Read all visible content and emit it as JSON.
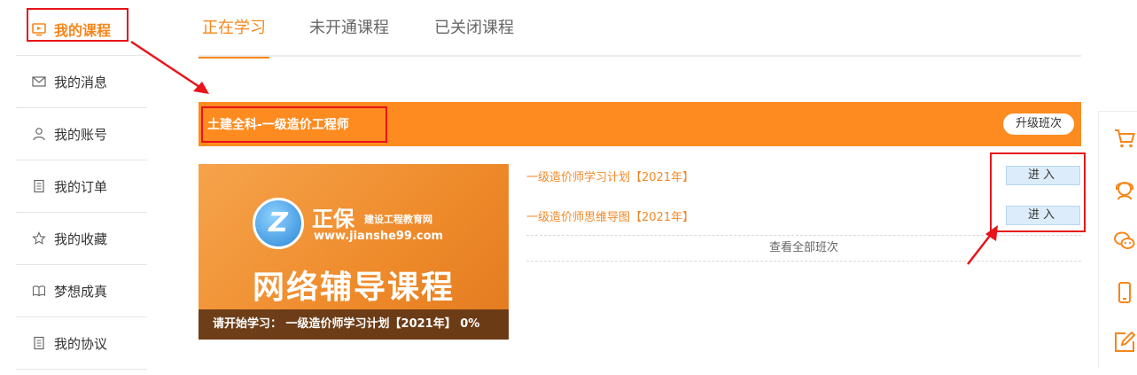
{
  "sidebar": {
    "items": [
      {
        "label": "我的课程",
        "icon": "video-icon",
        "active": true
      },
      {
        "label": "我的消息",
        "icon": "mail-icon"
      },
      {
        "label": "我的账号",
        "icon": "user-icon"
      },
      {
        "label": "我的订单",
        "icon": "document-icon"
      },
      {
        "label": "我的收藏",
        "icon": "star-icon"
      },
      {
        "label": "梦想成真",
        "icon": "book-icon"
      },
      {
        "label": "我的协议",
        "icon": "document-icon"
      }
    ]
  },
  "tabs": [
    {
      "label": "正在学习",
      "active": true
    },
    {
      "label": "未开通课程"
    },
    {
      "label": "已关闭课程"
    }
  ],
  "course": {
    "title": "土建全科-一级造价工程师",
    "upgrade_label": "升级班次",
    "cover": {
      "brand_name": "正保",
      "brand_sub": "建设工程教育网",
      "url": "www.jianshe99.com",
      "headline": "网络辅导课程",
      "status_text": "请开始学习： 一级造价师学习计划【2021年】 0%"
    },
    "plans": [
      {
        "name": "一级造价师学习计划【2021年】",
        "enter_label": "进入"
      },
      {
        "name": "一级造价师思维导图【2021年】",
        "enter_label": "进入"
      }
    ],
    "view_all_label": "查看全部班次"
  },
  "float_bar": {
    "icons": [
      "cart-icon",
      "support-icon",
      "wechat-icon",
      "mobile-icon",
      "edit-icon"
    ]
  },
  "colors": {
    "accent": "#f7861a",
    "header_bg": "#fd8b1f",
    "annotation_red": "#e8141a",
    "enter_btn_bg": "#dcecfa"
  }
}
